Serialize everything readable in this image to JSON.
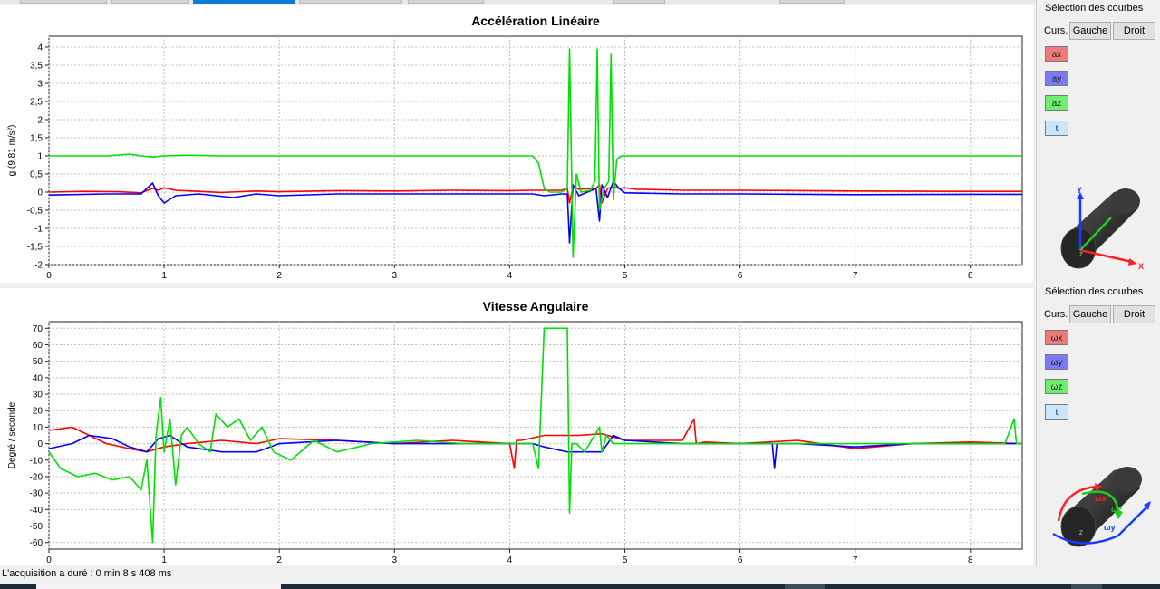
{
  "status": {
    "text": "L'acquisition a duré : 0 min 8 s 408 ms"
  },
  "panels": [
    {
      "side": {
        "title": "Sélection des courbes",
        "cursor_label": "Curs.",
        "left_button": "Gauche",
        "right_button": "Droit",
        "toggles": [
          {
            "label": "ax",
            "color": "#f07a7a"
          },
          {
            "label": "ay",
            "color": "#7a7af5"
          },
          {
            "label": "az",
            "color": "#6ef06e"
          },
          {
            "label": "t",
            "color": "#c9e6ff"
          }
        ],
        "axis_labels": [
          "Y",
          "X",
          "Z"
        ]
      }
    },
    {
      "side": {
        "title": "Sélection des courbes",
        "cursor_label": "Curs.",
        "left_button": "Gauche",
        "right_button": "Droit",
        "toggles": [
          {
            "label": "ωx",
            "color": "#f07a7a"
          },
          {
            "label": "ωy",
            "color": "#7a7af5"
          },
          {
            "label": "ωz",
            "color": "#6ef06e"
          },
          {
            "label": "t",
            "color": "#c9e6ff"
          }
        ],
        "axis_labels": [
          "ωx",
          "ωz",
          "ωy",
          "Z"
        ]
      }
    }
  ],
  "chart_data": [
    {
      "type": "line",
      "title": "Accélération Linéaire",
      "xlabel": "",
      "ylabel": "g (9.81 m/s²)",
      "xlim": [
        0,
        8.45
      ],
      "ylim": [
        -2,
        4.3
      ],
      "x_ticks": [
        "0",
        "1",
        "2",
        "3",
        "4",
        "5",
        "6",
        "7",
        "8"
      ],
      "x_tick_values": [
        0,
        1,
        2,
        3,
        4,
        5,
        6,
        7,
        8
      ],
      "y_ticks": [
        "-2",
        "-1,5",
        "-1",
        "-0,5",
        "0",
        "0,5",
        "1",
        "1,5",
        "2",
        "2,5",
        "3",
        "3,5",
        "4"
      ],
      "y_tick_values": [
        -2,
        -1.5,
        -1,
        -0.5,
        0,
        0.5,
        1,
        1.5,
        2,
        2.5,
        3,
        3.5,
        4
      ],
      "grid": true,
      "series": [
        {
          "name": "ax",
          "color": "#ff0000",
          "x": [
            0,
            0.3,
            0.6,
            0.8,
            0.9,
            0.95,
            1.0,
            1.1,
            1.3,
            1.5,
            1.8,
            2.0,
            2.5,
            3.0,
            3.5,
            4.0,
            4.2,
            4.3,
            4.45,
            4.5,
            4.52,
            4.55,
            4.6,
            4.75,
            4.78,
            4.8,
            4.85,
            4.9,
            4.95,
            5.0,
            5.1,
            5.5,
            6.0,
            7.0,
            8.0,
            8.45
          ],
          "y": [
            0,
            0.02,
            0.01,
            -0.02,
            0.1,
            0.05,
            0.12,
            0.05,
            0.02,
            -0.01,
            0.03,
            0.01,
            0.04,
            0.03,
            0.05,
            0.04,
            0.05,
            0.05,
            0.05,
            0.1,
            -0.3,
            0.15,
            0.08,
            0.1,
            0.2,
            -0.3,
            0.1,
            0.15,
            0.1,
            0.12,
            0.08,
            0.05,
            0.05,
            0.03,
            0.02,
            0.02
          ]
        },
        {
          "name": "ay",
          "color": "#0000ff",
          "x": [
            0,
            0.5,
            0.8,
            0.9,
            0.95,
            1.0,
            1.1,
            1.3,
            1.6,
            1.8,
            2.0,
            2.5,
            3.0,
            3.5,
            4.0,
            4.2,
            4.3,
            4.45,
            4.5,
            4.52,
            4.55,
            4.6,
            4.75,
            4.78,
            4.8,
            4.85,
            4.9,
            4.95,
            5.0,
            5.5,
            6.0,
            7.0,
            8.0,
            8.45
          ],
          "y": [
            -0.08,
            -0.05,
            -0.05,
            0.25,
            -0.1,
            -0.3,
            -0.1,
            -0.05,
            -0.15,
            -0.05,
            -0.1,
            -0.05,
            -0.05,
            -0.05,
            -0.05,
            -0.05,
            -0.1,
            -0.05,
            -0.05,
            -1.4,
            0.2,
            -0.1,
            0.1,
            -0.8,
            0.2,
            -0.15,
            0.3,
            0.1,
            -0.02,
            -0.05,
            -0.05,
            -0.07,
            -0.06,
            -0.06
          ]
        },
        {
          "name": "az",
          "color": "#00e000",
          "x": [
            0,
            0.5,
            0.7,
            0.8,
            0.9,
            1.0,
            1.2,
            1.5,
            2.0,
            2.5,
            3.0,
            3.5,
            4.0,
            4.2,
            4.25,
            4.3,
            4.35,
            4.45,
            4.5,
            4.52,
            4.55,
            4.58,
            4.62,
            4.7,
            4.74,
            4.76,
            4.78,
            4.82,
            4.86,
            4.88,
            4.9,
            4.93,
            4.97,
            5.0,
            5.1,
            6.0,
            7.0,
            8.0,
            8.45
          ],
          "y": [
            1.0,
            1.0,
            1.05,
            1.0,
            0.97,
            1.0,
            1.02,
            1.0,
            1.0,
            1.0,
            1.0,
            1.0,
            1.0,
            1.0,
            0.8,
            0.1,
            0.0,
            0.0,
            0.1,
            3.95,
            -1.8,
            0.5,
            0.0,
            0.05,
            0.3,
            3.95,
            -0.5,
            0.1,
            0.3,
            3.8,
            -0.2,
            0.9,
            1.0,
            1.0,
            1.0,
            1.0,
            1.0,
            1.0,
            1.0
          ]
        }
      ]
    },
    {
      "type": "line",
      "title": "Vitesse Angulaire",
      "xlabel": "",
      "ylabel": "Degré / seconde",
      "xlim": [
        0,
        8.45
      ],
      "ylim": [
        -64,
        74
      ],
      "x_ticks": [
        "0",
        "1",
        "2",
        "3",
        "4",
        "5",
        "6",
        "7",
        "8"
      ],
      "x_tick_values": [
        0,
        1,
        2,
        3,
        4,
        5,
        6,
        7,
        8
      ],
      "y_ticks": [
        "-60",
        "-50",
        "-40",
        "-30",
        "-20",
        "-10",
        "0",
        "10",
        "20",
        "30",
        "40",
        "50",
        "60",
        "70"
      ],
      "y_tick_values": [
        -60,
        -50,
        -40,
        -30,
        -20,
        -10,
        0,
        10,
        20,
        30,
        40,
        50,
        60,
        70
      ],
      "grid": true,
      "series": [
        {
          "name": "ωx",
          "color": "#ff0000",
          "x": [
            0,
            0.2,
            0.35,
            0.5,
            0.7,
            0.85,
            1.0,
            1.2,
            1.5,
            1.8,
            2.0,
            2.5,
            3.0,
            3.5,
            4.0,
            4.04,
            4.06,
            4.1,
            4.3,
            4.5,
            4.6,
            4.8,
            4.9,
            5.0,
            5.5,
            5.6,
            5.62,
            5.7,
            6.0,
            6.5,
            7.0,
            7.5,
            8.0,
            8.45
          ],
          "y": [
            8,
            10,
            5,
            0,
            -3,
            -5,
            -2,
            0,
            2,
            0,
            3,
            2,
            0,
            2,
            0,
            -15,
            2,
            2,
            5,
            5,
            5,
            6,
            4,
            2,
            2,
            15,
            0,
            1,
            0,
            2,
            -3,
            0,
            1,
            0
          ]
        },
        {
          "name": "ωy",
          "color": "#0000ff",
          "x": [
            0,
            0.2,
            0.35,
            0.55,
            0.7,
            0.85,
            0.95,
            1.05,
            1.2,
            1.5,
            1.8,
            2.0,
            2.5,
            3.0,
            3.5,
            4.0,
            4.2,
            4.3,
            4.5,
            4.6,
            4.7,
            4.8,
            4.9,
            5.0,
            5.5,
            6.0,
            6.28,
            6.3,
            6.32,
            6.5,
            7.0,
            7.5,
            8.0,
            8.45
          ],
          "y": [
            -3,
            0,
            5,
            3,
            -2,
            -5,
            3,
            5,
            -2,
            -5,
            -5,
            0,
            2,
            0,
            0,
            0,
            0,
            -2,
            -5,
            -5,
            -5,
            -5,
            5,
            2,
            0,
            0,
            0,
            -15,
            0,
            0,
            -2,
            0,
            0,
            0
          ]
        },
        {
          "name": "ωz",
          "color": "#00e000",
          "x": [
            0,
            0.1,
            0.25,
            0.4,
            0.55,
            0.7,
            0.8,
            0.85,
            0.9,
            0.93,
            0.97,
            1.0,
            1.05,
            1.1,
            1.15,
            1.2,
            1.3,
            1.4,
            1.45,
            1.55,
            1.65,
            1.75,
            1.85,
            1.95,
            2.1,
            2.3,
            2.5,
            2.8,
            3.2,
            3.6,
            4.0,
            4.2,
            4.25,
            4.3,
            4.5,
            4.52,
            4.54,
            4.58,
            4.65,
            4.78,
            4.8,
            4.84,
            4.9,
            5.0,
            5.5,
            6.0,
            7.0,
            8.0,
            8.3,
            8.38,
            8.4,
            8.45
          ],
          "y": [
            -5,
            -15,
            -20,
            -18,
            -22,
            -20,
            -28,
            -10,
            -60,
            5,
            28,
            -5,
            15,
            -25,
            5,
            10,
            0,
            -5,
            18,
            10,
            15,
            2,
            10,
            -5,
            -10,
            2,
            -5,
            0,
            2,
            0,
            0,
            0,
            -15,
            70,
            70,
            -42,
            0,
            0,
            -5,
            10,
            -5,
            5,
            0,
            0,
            0,
            0,
            0,
            0,
            0,
            15,
            0,
            0
          ]
        }
      ]
    }
  ]
}
